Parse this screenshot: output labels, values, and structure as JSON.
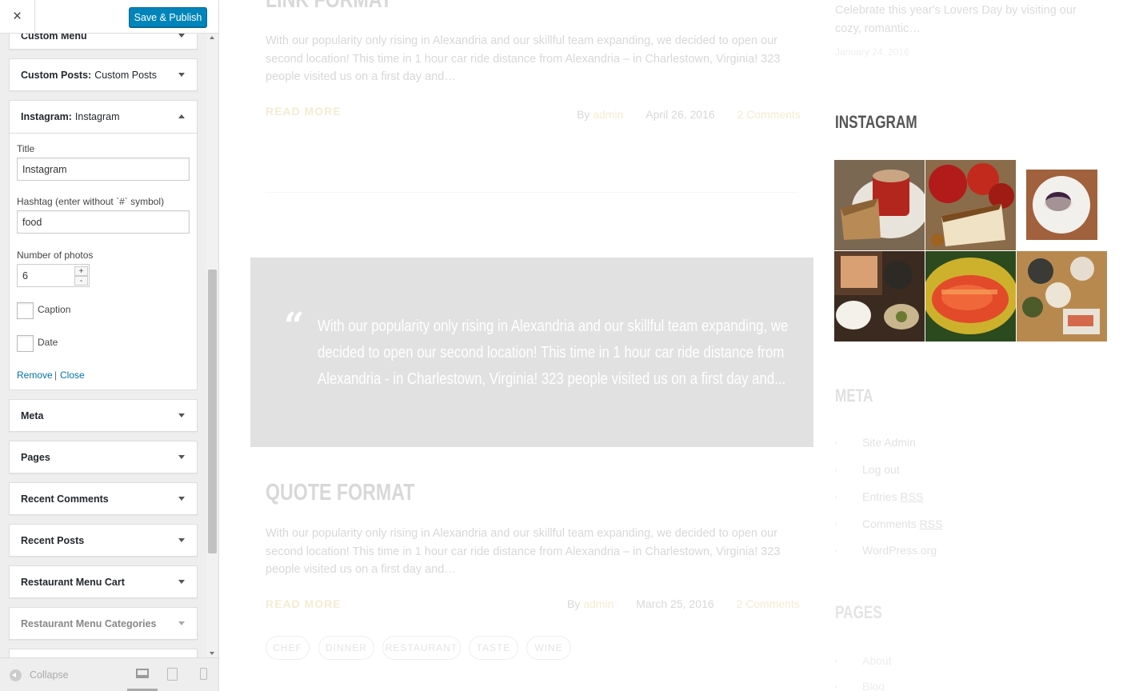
{
  "header": {
    "close_icon": "×",
    "save_label": "Save & Publish"
  },
  "widgets": {
    "custom_menu": "Custom Menu",
    "custom_posts": {
      "title": "Custom Posts:",
      "sub": "Custom Posts"
    },
    "instagram": {
      "title": "Instagram:",
      "sub": "Instagram"
    },
    "meta": "Meta",
    "pages": "Pages",
    "recent_comments": "Recent Comments",
    "recent_posts": "Recent Posts",
    "restaurant_menu_cart": "Restaurant Menu Cart",
    "restaurant_menu_categories": "Restaurant Menu Categories"
  },
  "form": {
    "title_label": "Title",
    "title_value": "Instagram",
    "hashtag_label": "Hashtag (enter without `#` symbol)",
    "hashtag_value": "food",
    "photos_label": "Number of photos",
    "photos_value": "6",
    "spin_up": "+",
    "spin_down": "-",
    "caption_label": "Caption",
    "date_label": "Date",
    "remove_link": "Remove",
    "separator": "|",
    "close_link": "Close"
  },
  "footer": {
    "collapse_label": "Collapse",
    "active_device": "desktop"
  },
  "preview": {
    "post1": {
      "title": "LINK FORMAT",
      "excerpt": "With our popularity only rising in Alexandria and our skillful team expanding, we decided to open our second location! This time in 1 hour car ride distance from Alexandria – in Charlestown, Virginia! 323 people visited us on a first day and…",
      "read_more": "READ MORE",
      "by": "By",
      "author": "admin",
      "date": "April 26, 2016",
      "comments": "2 Comments"
    },
    "quote": {
      "mark": "“",
      "text": "With our popularity only rising in Alexandria and our skillful team expanding, we decided to open our second location! This time in 1 hour car ride distance from Alexandria - in Charlestown, Virginia! 323 people visited us on a first day and..."
    },
    "post2": {
      "title": "QUOTE FORMAT",
      "excerpt": "With our popularity only rising in Alexandria and our skillful team expanding, we decided to open our second location! This time in 1 hour car ride distance from Alexandria – in Charlestown, Virginia! 323 people visited us on a first day and…",
      "read_more": "READ MORE",
      "by": "By",
      "author": "admin",
      "date": "March 25, 2016",
      "comments": "2 Comments"
    },
    "tags": [
      "CHEF",
      "DINNER",
      "RESTAURANT",
      "TASTE",
      "WINE"
    ],
    "sidebar": {
      "top_excerpt": "Celebrate this year's Lovers Day by visiting our cozy, romantic…",
      "top_date": "January 24, 2016",
      "instagram_title": "INSTAGRAM",
      "meta_title": "META",
      "meta_items": {
        "site_admin": "Site Admin",
        "log_out": "Log out",
        "entries": "Entries",
        "comments": "Comments",
        "rss": "RSS",
        "wordpress": "WordPress.org"
      },
      "bullet": "›",
      "pages_title": "PAGES",
      "pages_items": [
        "About",
        "Blog"
      ]
    }
  }
}
